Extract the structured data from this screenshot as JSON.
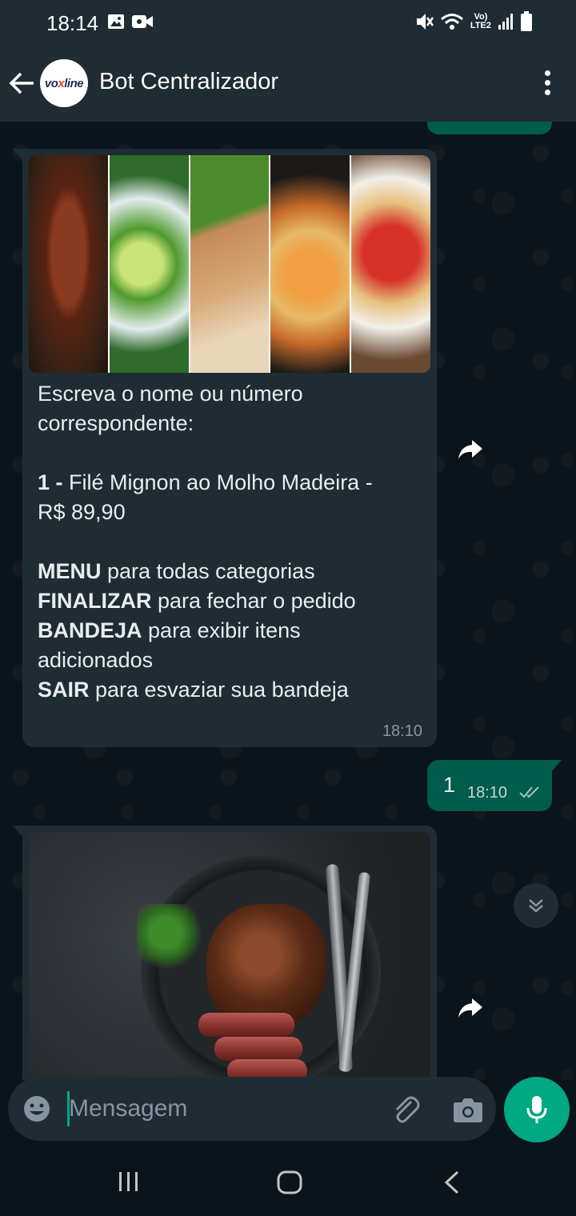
{
  "status_bar": {
    "time": "18:14",
    "left_icons": [
      "image-icon",
      "video-camera-icon"
    ],
    "right_icons": [
      "mute-icon",
      "wifi-icon",
      "volte-icon",
      "signal-icon",
      "battery-icon"
    ],
    "network_top": "Vo)",
    "network_bottom": "LTE2"
  },
  "header": {
    "title": "Bot Centralizador",
    "avatar_logo_part1": "vo",
    "avatar_logo_x": "x",
    "avatar_logo_part2": "line"
  },
  "messages": [
    {
      "direction": "incoming",
      "has_image": true,
      "image_description": "food-collage",
      "lines": [
        {
          "text": "Escreva o nome ou número"
        },
        {
          "text": "correspondente:"
        },
        {
          "text": ""
        },
        {
          "bold": "1 -",
          "text": " Filé Mignon ao Molho Madeira -"
        },
        {
          "text": "R$ 89,90"
        },
        {
          "text": ""
        },
        {
          "bold": "MENU",
          "text": " para todas categorias"
        },
        {
          "bold": "FINALIZAR",
          "text": " para fechar o pedido"
        },
        {
          "bold": "BANDEJA",
          "text": " para exibir itens"
        },
        {
          "text": "adicionados"
        },
        {
          "bold": "SAIR",
          "text": " para esvaziar sua bandeja"
        }
      ],
      "time": "18:10"
    },
    {
      "direction": "outgoing",
      "text": "1",
      "time": "18:10",
      "status": "read"
    },
    {
      "direction": "incoming",
      "has_image": true,
      "image_description": "steak-photo"
    }
  ],
  "input": {
    "placeholder": "Mensagem"
  },
  "colors": {
    "header_bg": "#1f2c34",
    "chat_bg": "#0b141a",
    "incoming_bubble": "#1f2c34",
    "outgoing_bubble": "#005c4b",
    "accent": "#00a884",
    "muted_text": "#8696a0"
  }
}
